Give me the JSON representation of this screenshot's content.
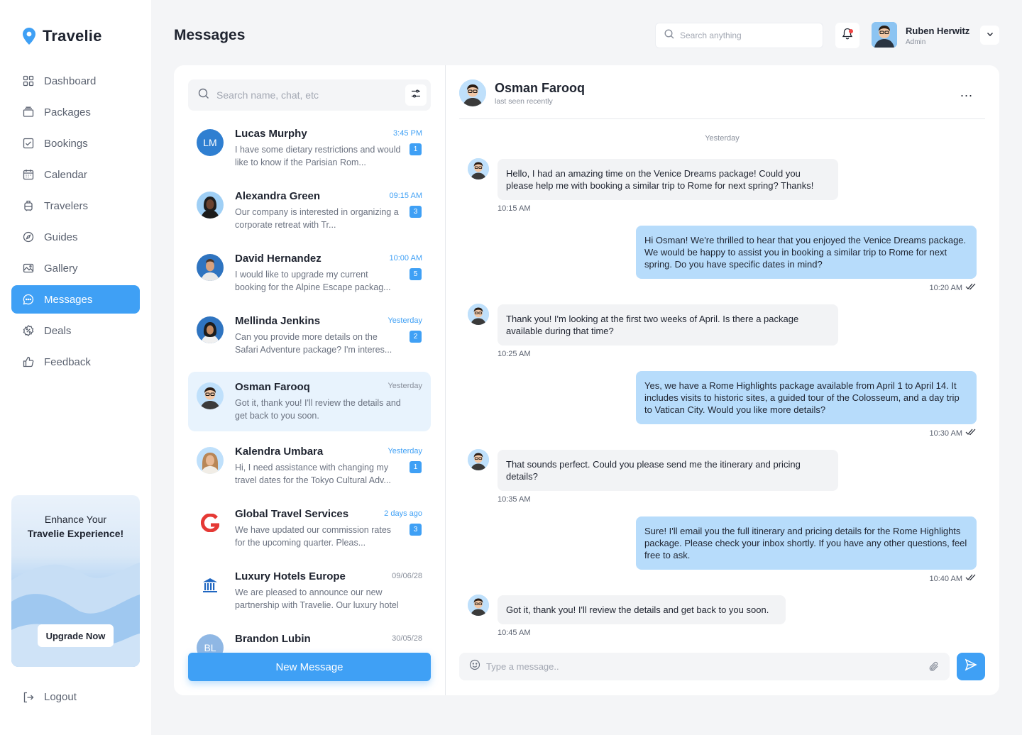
{
  "app": {
    "name": "Travelie"
  },
  "sidebar": {
    "items": [
      {
        "label": "Dashboard",
        "icon": "grid-icon"
      },
      {
        "label": "Packages",
        "icon": "package-icon"
      },
      {
        "label": "Bookings",
        "icon": "booking-check-icon"
      },
      {
        "label": "Calendar",
        "icon": "calendar-icon"
      },
      {
        "label": "Travelers",
        "icon": "luggage-icon"
      },
      {
        "label": "Guides",
        "icon": "compass-icon"
      },
      {
        "label": "Gallery",
        "icon": "image-icon"
      },
      {
        "label": "Messages",
        "icon": "chat-icon",
        "active": true
      },
      {
        "label": "Deals",
        "icon": "discount-icon"
      },
      {
        "label": "Feedback",
        "icon": "thumbs-up-icon"
      }
    ],
    "promo": {
      "line1": "Enhance Your",
      "line2": "Travelie Experience!",
      "button": "Upgrade Now"
    },
    "logout": "Logout"
  },
  "header": {
    "title": "Messages",
    "search_placeholder": "Search anything",
    "user": {
      "name": "Ruben Herwitz",
      "role": "Admin"
    }
  },
  "chat_list": {
    "search_placeholder": "Search name, chat, etc",
    "items": [
      {
        "name": "Lucas Murphy",
        "time": "3:45 PM",
        "preview": "I have some dietary restrictions and would like to know if the Parisian Rom...",
        "badge": "1",
        "initials": "LM"
      },
      {
        "name": "Alexandra Green",
        "time": "09:15 AM",
        "preview": "Our company is interested in organizing a corporate retreat with Tr...",
        "badge": "3"
      },
      {
        "name": "David Hernandez",
        "time": "10:00 AM",
        "preview": "I would like to upgrade my current booking for the Alpine Escape packag...",
        "badge": "5"
      },
      {
        "name": "Mellinda Jenkins",
        "time": "Yesterday",
        "preview": "Can you provide more details on the Safari Adventure package? I'm interes...",
        "badge": "2"
      },
      {
        "name": "Osman Farooq",
        "time": "Yesterday",
        "preview": "Got it, thank you! I'll review the details and get back to you soon.",
        "badge": ""
      },
      {
        "name": "Kalendra Umbara",
        "time": "Yesterday",
        "preview": "Hi, I need assistance with changing my travel dates for the Tokyo Cultural Adv...",
        "badge": "1"
      },
      {
        "name": "Global Travel Services",
        "time": "2 days ago",
        "preview": "We have updated our commission rates for the upcoming quarter. Pleas...",
        "badge": "3"
      },
      {
        "name": "Luxury Hotels Europe",
        "time": "09/06/28",
        "preview": "We are pleased to announce our new partnership with Travelie. Our luxury hotel c...",
        "badge": ""
      },
      {
        "name": "Brandon Lubin",
        "time": "30/05/28",
        "preview": "",
        "badge": "",
        "initials": "BL"
      }
    ],
    "new_message_label": "New Message"
  },
  "conversation": {
    "name": "Osman Farooq",
    "status": "last seen recently",
    "more": "...",
    "day_label": "Yesterday",
    "messages": [
      {
        "from": "in",
        "text": "Hello, I had an amazing time on the Venice Dreams package! Could you please help me with booking a similar trip to Rome for next spring? Thanks!",
        "time": "10:15 AM"
      },
      {
        "from": "out",
        "text": "Hi Osman! We're thrilled to hear that you enjoyed the Venice Dreams package. We would be happy to assist you in booking a similar trip to Rome for next spring. Do you have specific dates in mind?",
        "time": "10:20 AM"
      },
      {
        "from": "in",
        "text": "Thank you! I'm looking at the first two weeks of April. Is there a package available during that time?",
        "time": "10:25 AM"
      },
      {
        "from": "out",
        "text": "Yes, we have a Rome Highlights package available from April 1 to April 14. It includes visits to historic sites, a guided tour of the Colosseum, and a day trip to Vatican City. Would you like more details?",
        "time": "10:30 AM"
      },
      {
        "from": "in",
        "text": "That sounds perfect. Could you please send me the itinerary and pricing details?",
        "time": "10:35 AM"
      },
      {
        "from": "out",
        "text": "Sure! I'll email you the full itinerary and pricing details for the Rome Highlights package. Please check your inbox shortly. If you have any other questions, feel free to ask.",
        "time": "10:40 AM"
      },
      {
        "from": "in",
        "text": "Got it, thank you! I'll review the details and get back to you soon.",
        "time": "10:45 AM"
      }
    ],
    "composer_placeholder": "Type a message.."
  },
  "colors": {
    "accent": "#3fa0f5",
    "outgoing_bubble": "#b7dcfb",
    "incoming_bubble": "#f2f3f5",
    "notification_dot": "#ef4444"
  }
}
